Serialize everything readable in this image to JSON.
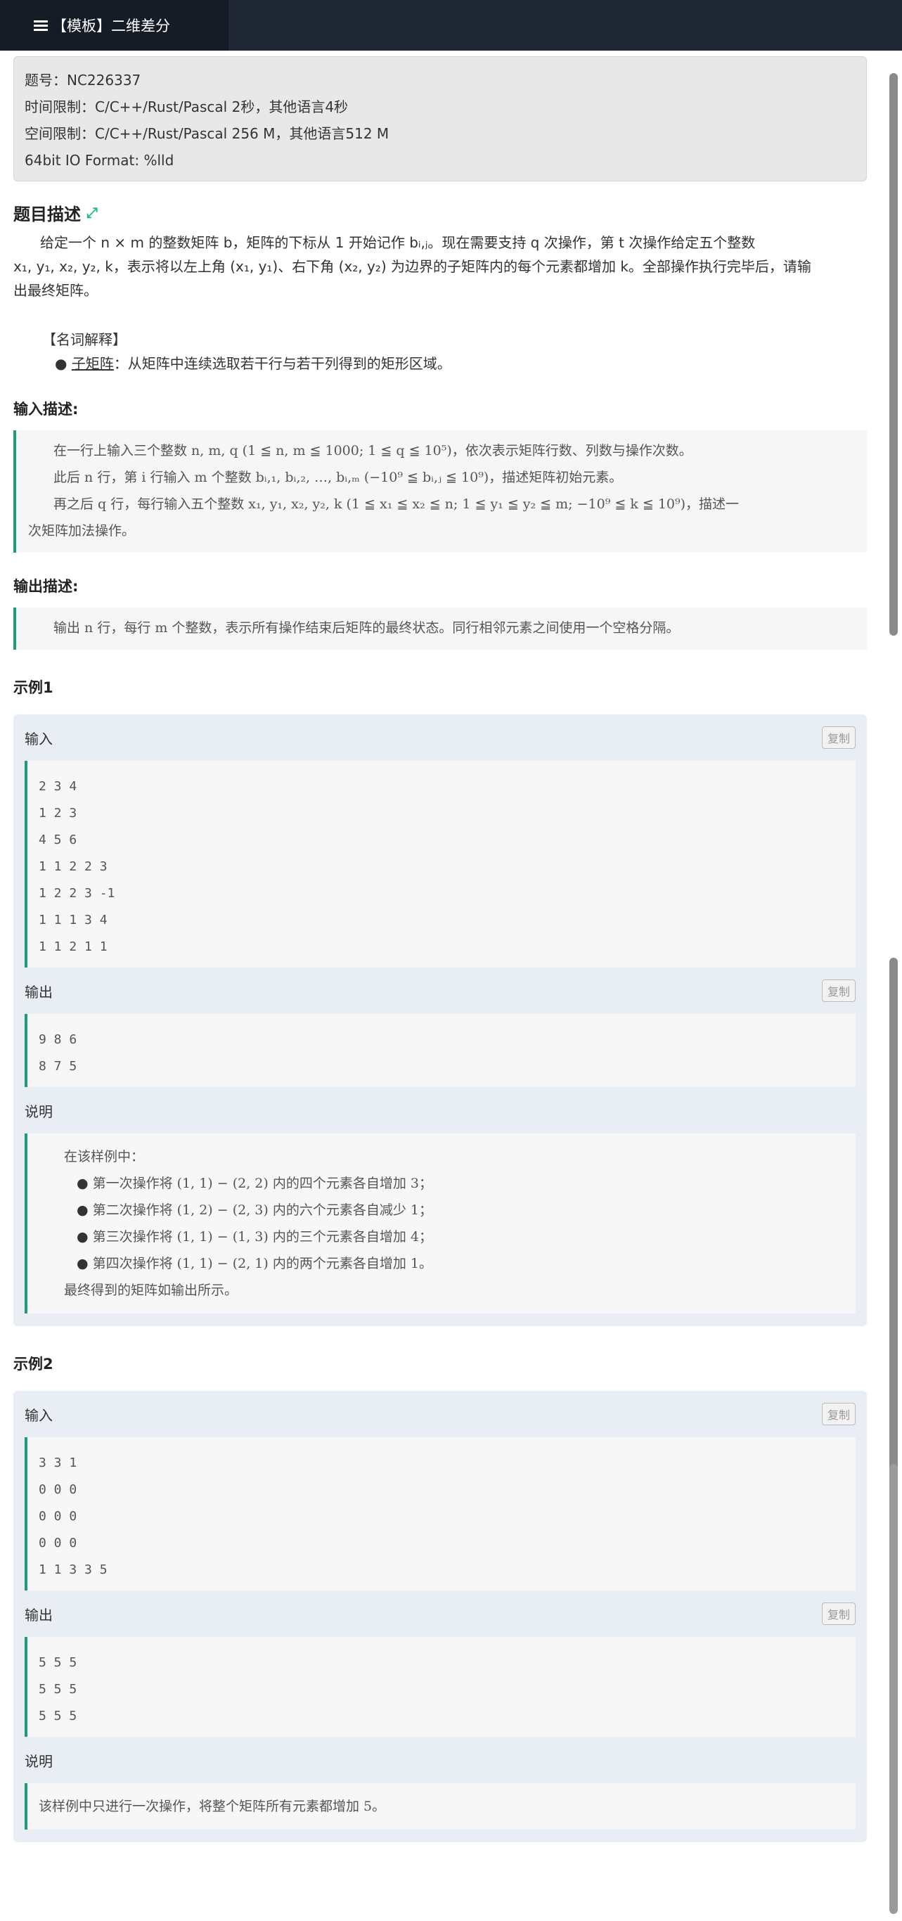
{
  "tab": {
    "title": "【模板】二维差分",
    "icon": "list-icon"
  },
  "meta": {
    "problem_id": "题号：NC226337",
    "time_limit": "时间限制：C/C++/Rust/Pascal 2秒，其他语言4秒",
    "memory_limit": "空间限制：C/C++/Rust/Pascal 256 M，其他语言512 M",
    "io_format": "64bit IO Format: %lld"
  },
  "description": {
    "heading": "题目描述",
    "expand_icon": "expand-icon",
    "para1_line1": "给定一个 n × m 的整数矩阵 b，矩阵的下标从 1 开始记作 bᵢ,ⱼ。现在需要支持 q 次操作，第 t 次操作给定五个整数",
    "para1_line2": "x₁, y₁, x₂, y₂, k，表示将以左上角 (x₁, y₁)、右下角 (x₂, y₂) 为边界的子矩阵内的每个元素都增加 k。全部操作执行完毕后，请输",
    "para1_line3": "出最终矩阵。",
    "terms_title": "【名词解释】",
    "term_name": "子矩阵",
    "term_def": "：从矩阵中连续选取若干行与若干列得到的矩形区域。"
  },
  "input": {
    "heading": "输入描述:",
    "line1": "在一行上输入三个整数 n, m, q (1 ≦ n, m ≦ 1000; 1 ≦ q ≦ 10⁵)，依次表示矩阵行数、列数与操作次数。",
    "line2": "此后 n 行，第 i 行输入 m 个整数 bᵢ,₁, bᵢ,₂, …, bᵢ,ₘ (−10⁹ ≦ bᵢ,ⱼ ≦ 10⁹)，描述矩阵初始元素。",
    "line3": "再之后 q 行，每行输入五个整数 x₁, y₁, x₂, y₂, k (1 ≦ x₁ ≦ x₂ ≦ n; 1 ≦ y₁ ≦ y₂ ≦ m; −10⁹ ≦ k ≦ 10⁹)，描述一",
    "line4": "次矩阵加法操作。"
  },
  "output": {
    "heading": "输出描述:",
    "line1": "输出 n 行，每行 m 个整数，表示所有操作结束后矩阵的最终状态。同行相邻元素之间使用一个空格分隔。"
  },
  "examples": [
    {
      "title": "示例1",
      "input_label": "输入",
      "output_label": "输出",
      "note_label": "说明",
      "copy_label": "复制",
      "input": [
        "2 3 4",
        "1 2 3",
        "4 5 6",
        "1 1 2 2 3",
        "1 2 2 3 -1",
        "1 1 1 3 4",
        "1 1 2 1 1"
      ],
      "output": [
        "9 8 6",
        "8 7 5"
      ],
      "note_intro": "在该样例中：",
      "note_items": [
        "第一次操作将 (1, 1) − (2, 2) 内的四个元素各自增加 3；",
        "第二次操作将 (1, 2) − (2, 3) 内的六个元素各自减少 1；",
        "第三次操作将 (1, 1) − (1, 3) 内的三个元素各自增加 4；",
        "第四次操作将 (1, 1) − (2, 1) 内的两个元素各自增加 1。"
      ],
      "note_end": "最终得到的矩阵如输出所示。"
    },
    {
      "title": "示例2",
      "input_label": "输入",
      "output_label": "输出",
      "note_label": "说明",
      "copy_label": "复制",
      "input": [
        "3 3 1",
        "0 0 0",
        "0 0 0",
        "0 0 0",
        "1 1 3 3 5"
      ],
      "output": [
        "5 5 5",
        "5 5 5",
        "5 5 5"
      ],
      "note_text": "该样例中只进行一次操作，将整个矩阵所有元素都增加 5。"
    }
  ]
}
